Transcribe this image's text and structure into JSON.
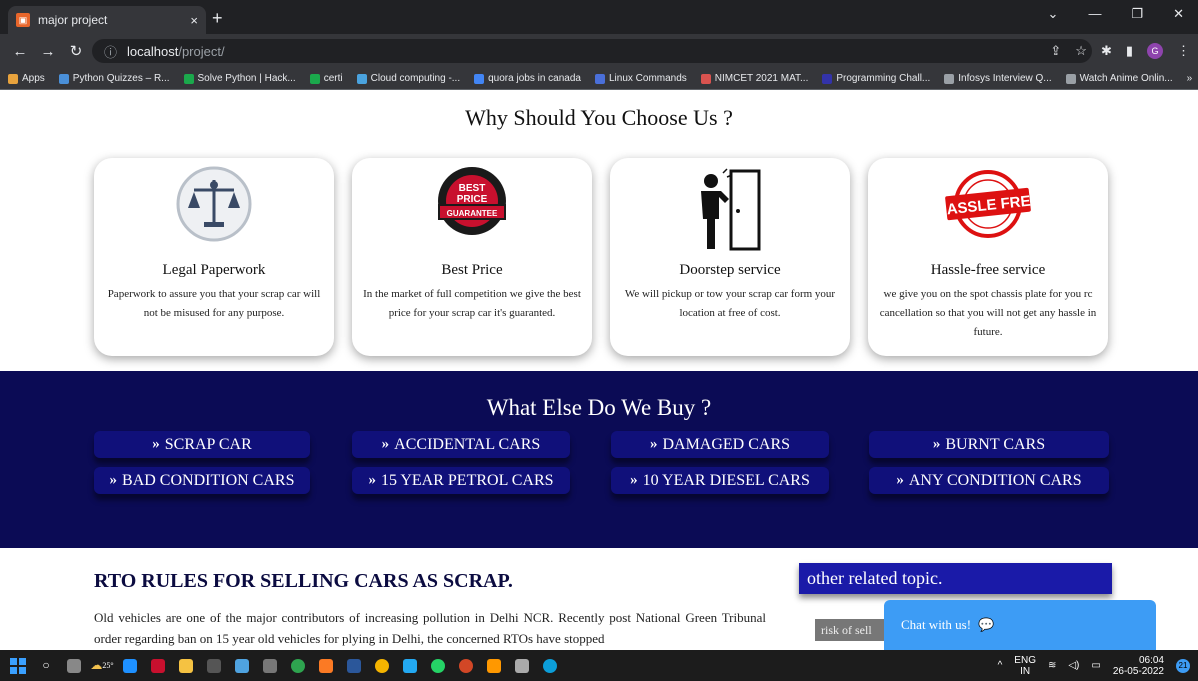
{
  "browser": {
    "tab_title": "major project",
    "tab_close": "×",
    "new_tab": "+",
    "url_host": "localhost",
    "url_path": "/project/",
    "win_minimize": "—",
    "win_maximize": "❐",
    "win_close": "✕",
    "profile_letter": "G",
    "bookmarks": [
      {
        "label": "Apps",
        "color": "#e8a33d"
      },
      {
        "label": "Python Quizzes – R...",
        "color": "#4a90d9"
      },
      {
        "label": "Solve Python | Hack...",
        "color": "#1ba94c"
      },
      {
        "label": "certi",
        "color": "#1ba94c"
      },
      {
        "label": "Cloud computing -...",
        "color": "#4aa3df"
      },
      {
        "label": "quora jobs in canada",
        "color": "#4285f4"
      },
      {
        "label": "Linux Commands",
        "color": "#4a6fd9"
      },
      {
        "label": "NIMCET 2021 MAT...",
        "color": "#d9534f"
      },
      {
        "label": "Programming Chall...",
        "color": "#3333aa"
      },
      {
        "label": "Infosys Interview Q...",
        "color": "#9aa0a6"
      },
      {
        "label": "Watch Anime Onlin...",
        "color": "#9aa0a6"
      }
    ],
    "bookmarks_more": "»"
  },
  "page": {
    "why_title": "Why Should You Choose Us ?",
    "cards": [
      {
        "title": "Legal Paperwork",
        "text": "Paperwork to assure you that your scrap car will not be misused for any purpose."
      },
      {
        "title": "Best Price",
        "text": "In the market of full competition we give the best price for your scrap car it's guaranted."
      },
      {
        "title": "Doorstep service",
        "text": "We will pickup or tow your scrap car form your location at free of cost."
      },
      {
        "title": "Hassle-free service",
        "text": "we give you on the spot chassis plate for you rc cancellation so that you will not get any hassle in future."
      }
    ],
    "badge_best": {
      "top": "BEST PRICE GUARANTEE",
      "big1": "BEST",
      "big2": "PRICE",
      "ribbon": "GUARANTEE"
    },
    "badge_hassle": {
      "ring_top": "HASSLE FREE",
      "main": "HASSLE FREE",
      "ring_bottom": "HASSLE FREE"
    },
    "buy_title": "What Else Do We Buy ?",
    "buy_items": [
      "SCRAP CAR",
      "ACCIDENTAL CARS",
      "DAMAGED CARS",
      "BURNT CARS",
      "BAD CONDITION CARS",
      "15 YEAR PETROL CARS",
      "10 YEAR DIESEL CARS",
      "ANY CONDITION CARS"
    ],
    "buy_chevron": "»",
    "rto_title": "RTO RULES FOR SELLING CARS AS SCRAP.",
    "rto_para": "Old vehicles are one of the major contributors of increasing pollution in Delhi NCR. Recently post National Green Tribunal order regarding ban on 15 year old vehicles for plying in Delhi, the concerned RTOs have stopped",
    "side_topic": "other related topic.",
    "side_link": "risk of sell",
    "chat_label": "Chat with us!"
  },
  "taskbar": {
    "weather": "25°",
    "lang_top": "ENG",
    "lang_bottom": "IN",
    "time": "06:04",
    "date": "26-05-2022",
    "notifications": "21"
  }
}
